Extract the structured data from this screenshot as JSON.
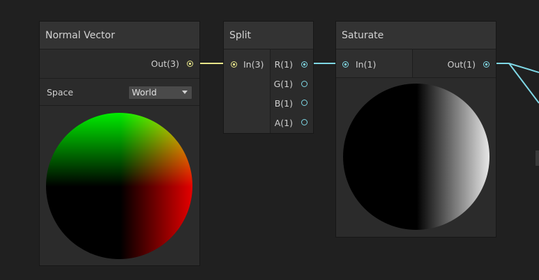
{
  "nodes": {
    "normal_vector": {
      "title": "Normal Vector",
      "output_label": "Out(3)",
      "space_label": "Space",
      "space_value": "World",
      "preview": "normal-sphere-preview"
    },
    "split": {
      "title": "Split",
      "input_label": "In(3)",
      "outputs": [
        "R(1)",
        "G(1)",
        "B(1)",
        "A(1)"
      ]
    },
    "saturate": {
      "title": "Saturate",
      "input_label": "In(1)",
      "output_label": "Out(1)",
      "preview": "grayscale-sphere-preview"
    }
  },
  "colors": {
    "vector3_port": "#e8e68a",
    "float_port": "#7fd8e6",
    "background": "#202020",
    "node_body": "#2b2b2b",
    "node_header": "#333333"
  }
}
